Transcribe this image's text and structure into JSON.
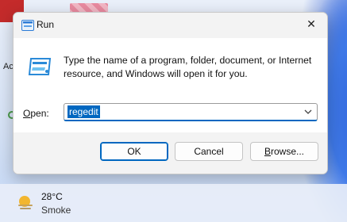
{
  "window": {
    "title": "Run",
    "close_glyph": "✕"
  },
  "content": {
    "icon": "run-icon",
    "description": "Type the name of a program, folder, document, or Internet resource, and Windows will open it for you.",
    "open_label_access_key": "O",
    "open_label_rest": "pen:",
    "open_value": "regedit"
  },
  "buttons": {
    "ok": "OK",
    "cancel": "Cancel",
    "browse_access_key": "B",
    "browse_rest": "rowse..."
  },
  "taskbar": {
    "weather_icon": "sun-haze-icon",
    "temperature": "28°C",
    "condition": "Smoke"
  },
  "desktop": {
    "partial_label": "Ac"
  },
  "colors": {
    "accent": "#0067c0",
    "dialog_bg": "#f3f3f3",
    "content_bg": "#ffffff"
  }
}
